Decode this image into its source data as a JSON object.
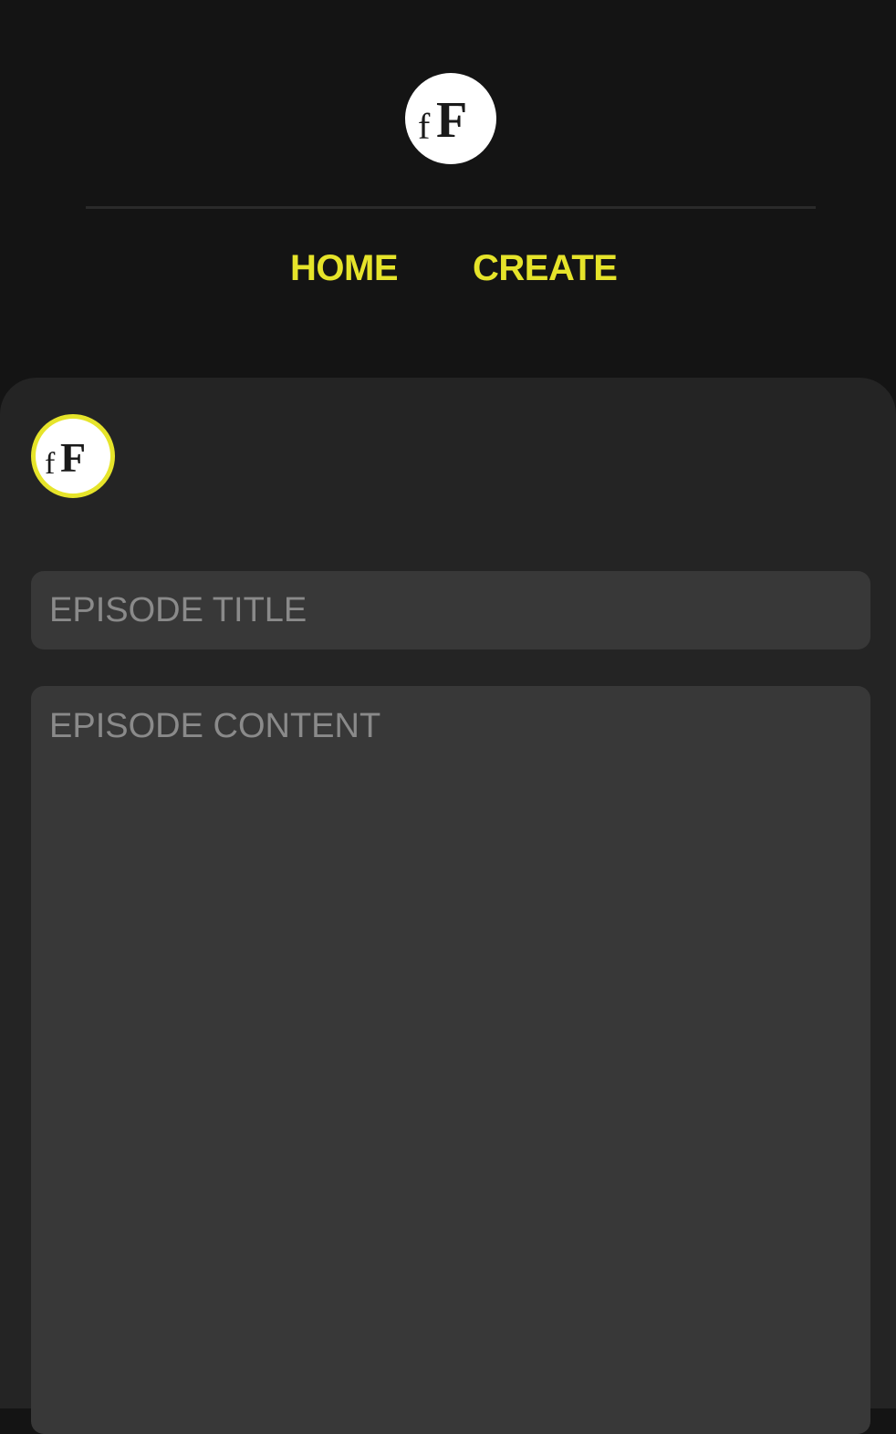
{
  "brand": {
    "logo_text": "fF",
    "accent_color": "#e6e42a",
    "background_color": "#141414",
    "panel_color": "#242424",
    "field_color": "#383838"
  },
  "nav": {
    "items": [
      {
        "label": "HOME"
      },
      {
        "label": "CREATE"
      }
    ]
  },
  "form": {
    "avatar_icon": "fF-logo-avatar",
    "title_placeholder": "EPISODE TITLE",
    "title_value": "",
    "content_placeholder": "EPISODE CONTENT",
    "content_value": ""
  }
}
